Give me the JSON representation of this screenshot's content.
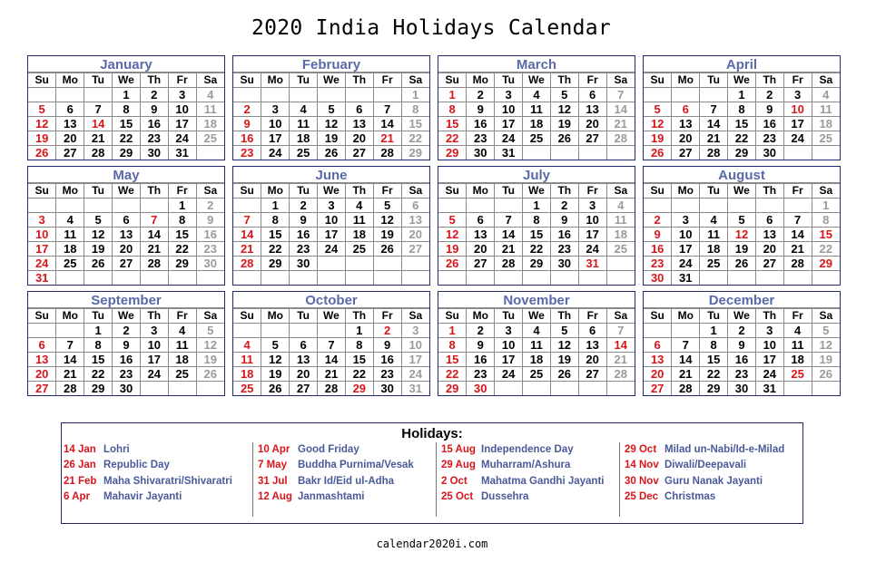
{
  "title": "2020 India Holidays Calendar",
  "weekdays": [
    "Su",
    "Mo",
    "Tu",
    "We",
    "Th",
    "Fr",
    "Sa"
  ],
  "colors": {
    "sunday": "#d8151b",
    "saturday": "#9a9a9a",
    "holiday": "#d8151b",
    "month_name": "#5a6aa8",
    "holiday_name": "#4a5a9a",
    "border": "#23276b"
  },
  "months": [
    {
      "name": "January",
      "start": 3,
      "days": 31,
      "holidays": [
        14
      ]
    },
    {
      "name": "February",
      "start": 6,
      "days": 29,
      "holidays": [
        21
      ]
    },
    {
      "name": "March",
      "start": 0,
      "days": 31,
      "holidays": []
    },
    {
      "name": "April",
      "start": 3,
      "days": 30,
      "holidays": [
        6,
        10
      ]
    },
    {
      "name": "May",
      "start": 5,
      "days": 31,
      "holidays": [
        7
      ]
    },
    {
      "name": "June",
      "start": 1,
      "days": 30,
      "holidays": []
    },
    {
      "name": "July",
      "start": 3,
      "days": 31,
      "holidays": [
        31
      ]
    },
    {
      "name": "August",
      "start": 6,
      "days": 31,
      "holidays": [
        12,
        15,
        29
      ]
    },
    {
      "name": "September",
      "start": 2,
      "days": 30,
      "holidays": []
    },
    {
      "name": "October",
      "start": 4,
      "days": 31,
      "holidays": [
        2,
        29
      ]
    },
    {
      "name": "November",
      "start": 0,
      "days": 30,
      "holidays": [
        14,
        30
      ]
    },
    {
      "name": "December",
      "start": 2,
      "days": 31,
      "holidays": [
        25
      ]
    }
  ],
  "holidays_title": "Holidays:",
  "holidays": [
    [
      {
        "date": "14 Jan",
        "name": "Lohri"
      },
      {
        "date": "26 Jan",
        "name": "Republic Day"
      },
      {
        "date": "21 Feb",
        "name": "Maha Shivaratri/Shivaratri"
      },
      {
        "date": "6 Apr",
        "name": "Mahavir Jayanti"
      }
    ],
    [
      {
        "date": "10 Apr",
        "name": "Good Friday"
      },
      {
        "date": "7 May",
        "name": "Buddha Purnima/Vesak"
      },
      {
        "date": "31 Jul",
        "name": "Bakr Id/Eid ul-Adha"
      },
      {
        "date": "12 Aug",
        "name": "Janmashtami"
      }
    ],
    [
      {
        "date": "15 Aug",
        "name": "Independence Day"
      },
      {
        "date": "29 Aug",
        "name": "Muharram/Ashura"
      },
      {
        "date": "2 Oct",
        "name": "Mahatma Gandhi Jayanti"
      },
      {
        "date": "25 Oct",
        "name": "Dussehra"
      }
    ],
    [
      {
        "date": "29 Oct",
        "name": "Milad un-Nabi/Id-e-Milad"
      },
      {
        "date": "14 Nov",
        "name": "Diwali/Deepavali"
      },
      {
        "date": "30 Nov",
        "name": "Guru Nanak Jayanti"
      },
      {
        "date": "25 Dec",
        "name": "Christmas"
      }
    ]
  ],
  "footer": "calendar2020i.com"
}
